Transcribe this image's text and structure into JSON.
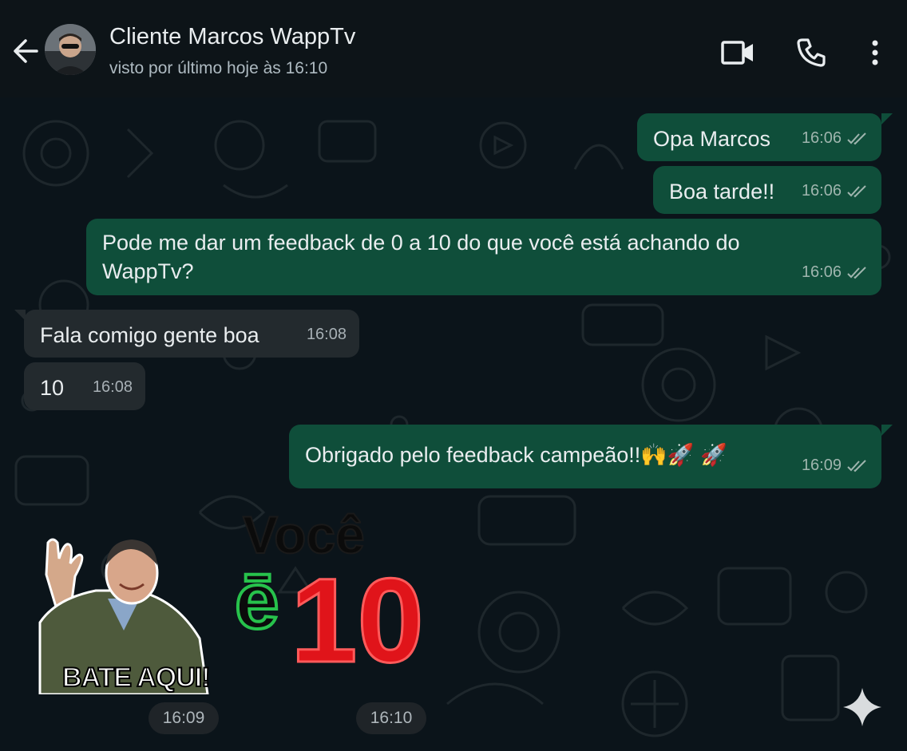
{
  "header": {
    "contact_name": "Cliente Marcos WappTv",
    "status": "visto por último hoje às 16:10",
    "icons": [
      "back-arrow-icon",
      "video-call-icon",
      "phone-icon",
      "more-options-icon"
    ]
  },
  "messages": [
    {
      "direction": "out",
      "text": "Opa Marcos",
      "time": "16:06",
      "read": true
    },
    {
      "direction": "out",
      "text": "Boa tarde!!",
      "time": "16:06",
      "read": true
    },
    {
      "direction": "out",
      "text_line1": "Pode me dar um feedback de 0 a 10 do que você está achando do",
      "text_line2": "WappTv?",
      "time": "16:06",
      "read": true
    },
    {
      "direction": "in",
      "text": "Fala comigo gente boa",
      "time": "16:08"
    },
    {
      "direction": "in",
      "text": "10",
      "time": "16:08"
    },
    {
      "direction": "out",
      "text": "Obrigado pelo feedback campeão!!🙌🚀 🚀",
      "time": "16:09",
      "read": true
    }
  ],
  "stickers": [
    {
      "caption": "BATE AQUI!",
      "time": "16:09"
    },
    {
      "caption_top": "Você",
      "caption_e": "ē",
      "caption_num": "10",
      "time": "16:10"
    }
  ],
  "colors": {
    "background": "#0b141a",
    "outgoing_bubble": "#0f4e3a",
    "incoming_bubble": "#232a2e",
    "read_tick": "#9fb5ae"
  }
}
